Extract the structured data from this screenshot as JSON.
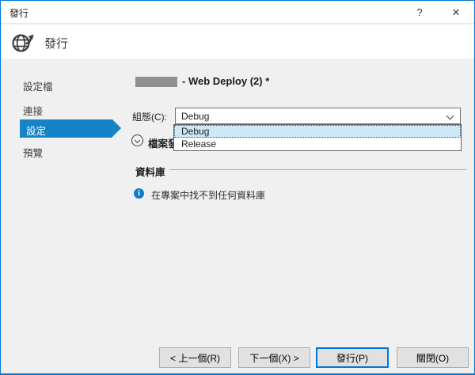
{
  "window": {
    "title": "發行",
    "help": "?",
    "close": "×"
  },
  "header": {
    "title": "發行"
  },
  "sidebar": {
    "items": [
      {
        "label": "設定檔",
        "selected": false
      },
      {
        "label": "連接",
        "selected": false
      },
      {
        "label": "設定",
        "selected": true
      },
      {
        "label": "預覽",
        "selected": false
      }
    ]
  },
  "settings": {
    "profile_suffix": "- Web Deploy (2) *",
    "configuration": {
      "label": "組態(C):",
      "value": "Debug",
      "options": [
        {
          "label": "Debug",
          "selected": true
        },
        {
          "label": "Release",
          "selected": false
        }
      ]
    },
    "file_options_label": "檔案發",
    "database": {
      "title": "資料庫",
      "message": "在專案中找不到任何資料庫"
    }
  },
  "footer": {
    "buttons": [
      {
        "label": "< 上一個(R)",
        "default": false
      },
      {
        "label": "下一個(X) >",
        "default": false
      },
      {
        "label": "發行(P)",
        "default": true
      },
      {
        "label": "關閉(O)",
        "default": false
      }
    ]
  },
  "colors": {
    "accent": "#0078d7",
    "nav_selected": "#1683c9",
    "option_selected_bg": "#cde9f8",
    "info_icon": "#0c7cc9",
    "content_bg": "#f0f0f0"
  }
}
